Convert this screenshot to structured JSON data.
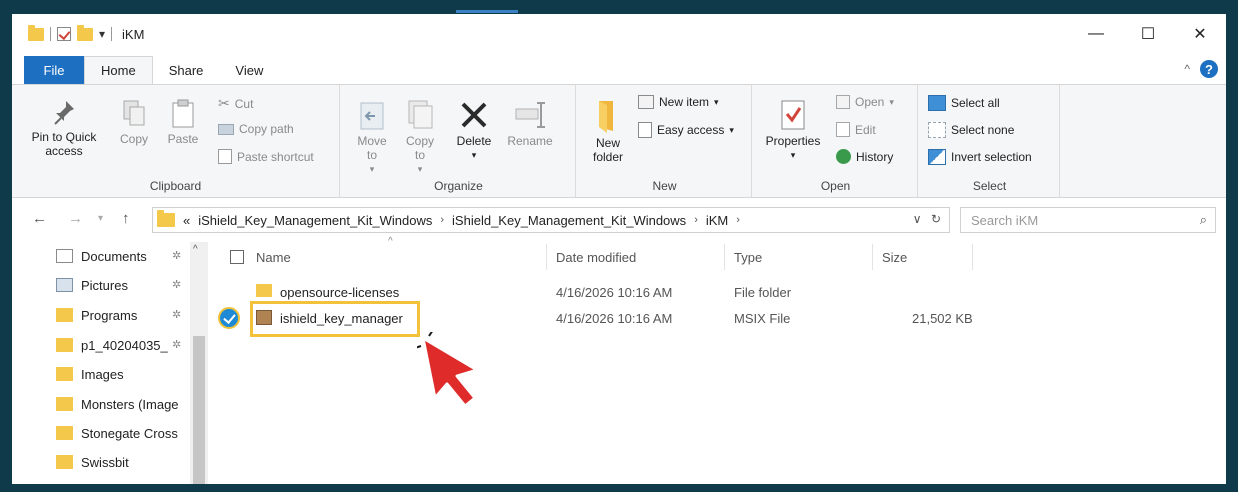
{
  "window": {
    "title": "iKM",
    "controls": {
      "minimize": "—",
      "maximize": "☐",
      "close": "✕"
    }
  },
  "tabs": {
    "file": "File",
    "home": "Home",
    "share": "Share",
    "view": "View"
  },
  "ribbon": {
    "clipboard": {
      "label": "Clipboard",
      "pin": "Pin to Quick access",
      "copy": "Copy",
      "paste": "Paste",
      "cut": "Cut",
      "copy_path": "Copy path",
      "paste_shortcut": "Paste shortcut"
    },
    "organize": {
      "label": "Organize",
      "move_to": "Move to",
      "copy_to": "Copy to",
      "delete": "Delete",
      "rename": "Rename"
    },
    "new": {
      "label": "New",
      "new_folder": "New folder",
      "new_item": "New item",
      "easy_access": "Easy access"
    },
    "open": {
      "label": "Open",
      "properties": "Properties",
      "open": "Open",
      "edit": "Edit",
      "history": "History"
    },
    "select": {
      "label": "Select",
      "select_all": "Select all",
      "select_none": "Select none",
      "invert": "Invert selection"
    }
  },
  "address": {
    "overflow": "«",
    "crumbs": [
      "iShield_Key_Management_Kit_Windows",
      "iShield_Key_Management_Kit_Windows",
      "iKM"
    ],
    "search_placeholder": "Search iKM"
  },
  "nav": {
    "items": [
      {
        "label": "Documents",
        "pinned": true
      },
      {
        "label": "Pictures",
        "pinned": true
      },
      {
        "label": "Programs",
        "pinned": true
      },
      {
        "label": "p1_40204035_",
        "pinned": true
      },
      {
        "label": "Images",
        "pinned": false
      },
      {
        "label": "Monsters (Image",
        "pinned": false
      },
      {
        "label": "Stonegate Cross",
        "pinned": false
      },
      {
        "label": "Swissbit",
        "pinned": false
      }
    ]
  },
  "columns": {
    "name": "Name",
    "date": "Date modified",
    "type": "Type",
    "size": "Size"
  },
  "files": [
    {
      "name": "opensource-licenses",
      "date": "4/16/2026 10:16 AM",
      "type": "File folder",
      "size": ""
    },
    {
      "name": "ishield_key_manager",
      "date": "4/16/2026 10:16 AM",
      "type": "MSIX File",
      "size": "21,502 KB"
    }
  ],
  "colors": {
    "accent": "#1d6fc1",
    "highlight": "#f2c33a",
    "cursor": "#e02b2b",
    "frame": "#0f3a4a"
  }
}
